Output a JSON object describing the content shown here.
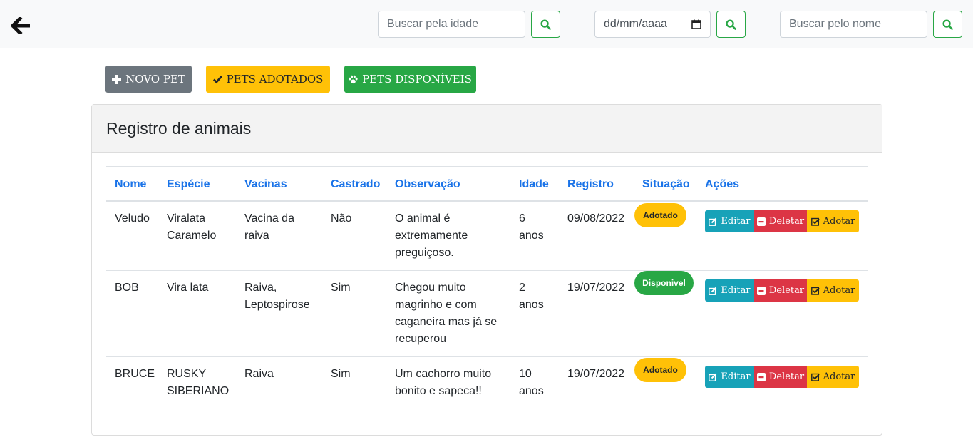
{
  "topbar": {
    "back_icon": "arrow-left-icon",
    "age_search_placeholder": "Buscar pela idade",
    "date_placeholder": "dd/mm/aaaa",
    "name_search_placeholder": "Buscar pelo nome"
  },
  "actions": {
    "new_pet": "NOVO PET",
    "adopted": "PETS ADOTADOS",
    "available": "PETS DISPONÍVEIS"
  },
  "card": {
    "title": "Registro de animais"
  },
  "table": {
    "headers": [
      "Nome",
      "Espécie",
      "Vacinas",
      "Castrado",
      "Observação",
      "Idade",
      "Registro",
      "Situação",
      "Ações"
    ],
    "rows": [
      {
        "nome": "Veludo",
        "especie": [
          "Viralata",
          "Caramelo"
        ],
        "vacinas": [
          "Vacina da",
          "raiva"
        ],
        "castrado": "Não",
        "observacao": [
          "O animal é",
          "extremamente",
          "preguiçoso."
        ],
        "idade": [
          "6",
          "anos"
        ],
        "registro": "09/08/2022",
        "situacao": "Adotado"
      },
      {
        "nome": "BOB",
        "especie": [
          "Vira lata"
        ],
        "vacinas": [
          "Raiva,",
          "Leptospirose"
        ],
        "castrado": "Sim",
        "observacao": [
          "Chegou muito",
          "magrinho e com",
          "caganeira mas já se",
          "recuperou"
        ],
        "idade": [
          "2",
          "anos"
        ],
        "registro": "19/07/2022",
        "situacao": "Disponivel"
      },
      {
        "nome": "BRUCE",
        "especie": [
          "RUSKY",
          "SIBERIANO"
        ],
        "vacinas": [
          "Raiva"
        ],
        "castrado": "Sim",
        "observacao": [
          "Um cachorro muito",
          "bonito e sapeca!!"
        ],
        "idade": [
          "10",
          "anos"
        ],
        "registro": "19/07/2022",
        "situacao": "Adotado"
      }
    ],
    "row_buttons": {
      "edit": "Editar",
      "delete": "Deletar",
      "adopt": "Adotar"
    }
  },
  "colors": {
    "primary_text": "#1a73e8",
    "success": "#28a745",
    "warning": "#ffc107",
    "danger": "#dc3545",
    "info": "#17a2b8",
    "secondary": "#6c757d"
  }
}
